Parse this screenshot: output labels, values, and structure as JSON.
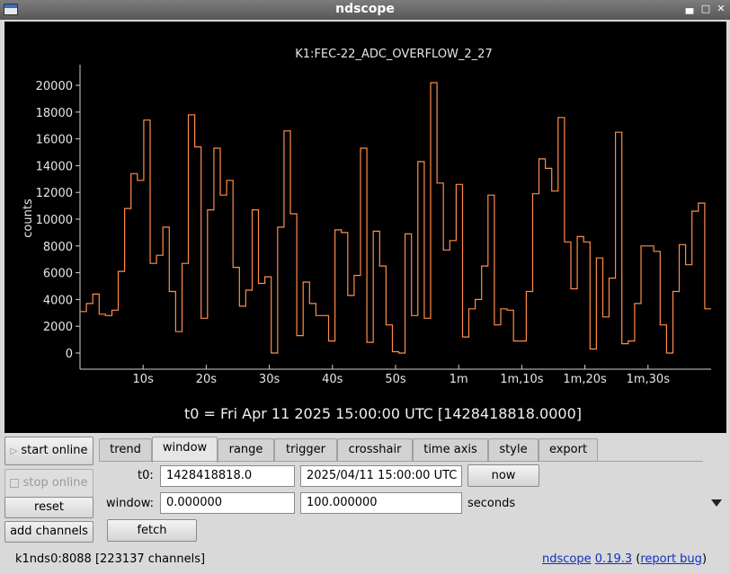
{
  "window": {
    "title": "ndscope"
  },
  "plot": {
    "channel_title": "K1:FEC-22_ADC_OVERFLOW_2_27",
    "t0_text": "t0 = Fri Apr 11 2025 15:00:00 UTC [1428418818.0000]",
    "trace_color": "#ff8c4a"
  },
  "chart_data": {
    "type": "line",
    "title": "K1:FEC-22_ADC_OVERFLOW_2_27",
    "xlabel": "",
    "ylabel": "counts",
    "xlim": [
      0,
      100
    ],
    "ylim": [
      -1200,
      21200
    ],
    "yticks": [
      0,
      2000,
      4000,
      6000,
      8000,
      10000,
      12000,
      14000,
      16000,
      18000,
      20000
    ],
    "xticks": [
      10,
      20,
      30,
      40,
      50,
      60,
      70,
      80,
      90
    ],
    "xtick_labels": [
      "10s",
      "20s",
      "30s",
      "40s",
      "50s",
      "1m",
      "1m,10s",
      "1m,20s",
      "1m,30s"
    ],
    "step": "post",
    "series": [
      {
        "values": [
          3100,
          3700,
          4400,
          2900,
          2800,
          3200,
          6100,
          10800,
          13400,
          12900,
          17400,
          6700,
          7300,
          9400,
          4600,
          1600,
          6700,
          17800,
          15400,
          2600,
          10700,
          15300,
          11800,
          12900,
          6400,
          3500,
          4700,
          10700,
          5200,
          5700,
          0,
          9400,
          16600,
          10400,
          1300,
          5300,
          3700,
          2800,
          2800,
          900,
          9200,
          9000,
          4300,
          5800,
          15300,
          800,
          9100,
          6500,
          2100,
          100,
          0,
          8900,
          2800,
          14300,
          2600,
          20200,
          12700,
          7700,
          8400,
          12600,
          1200,
          3300,
          4000,
          6500,
          11800,
          2100,
          3300,
          3200,
          900,
          900,
          4600,
          11900,
          14500,
          13800,
          12100,
          17600,
          8300,
          4800,
          8700,
          8300,
          300,
          7100,
          2700,
          5600,
          16500,
          700,
          900,
          3700,
          8000,
          8000,
          7600,
          2100,
          0,
          4600,
          8100,
          6600,
          10600,
          11200,
          3300
        ]
      }
    ]
  },
  "tabs": [
    "trend",
    "window",
    "range",
    "trigger",
    "crosshair",
    "time axis",
    "style",
    "export"
  ],
  "active_tab": "window",
  "left_buttons": {
    "start_online": "start online",
    "stop_online": "stop online",
    "reset": "reset",
    "add_channels": "add channels"
  },
  "window_tab": {
    "t0_label": "t0:",
    "t0_gps": "1428418818.0",
    "t0_utc": "2025/04/11 15:00:00 UTC",
    "now_label": "now",
    "window_label": "window:",
    "window_start": "0.000000",
    "window_end": "100.000000",
    "seconds_label": "seconds",
    "fetch_label": "fetch"
  },
  "status": {
    "server": "k1nds0:8088",
    "channels": "[223137 channels]",
    "app_link": "ndscope",
    "version_link": "0.19.3",
    "report_link": "report bug"
  }
}
